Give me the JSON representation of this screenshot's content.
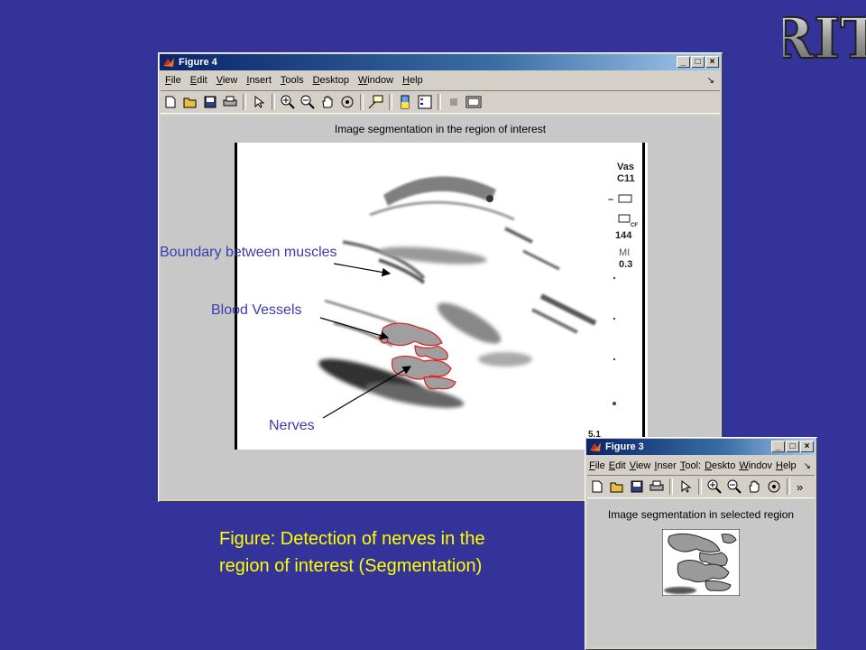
{
  "logo": {
    "text": "RIT"
  },
  "figure4": {
    "title": "Figure 4",
    "menu": [
      "File",
      "Edit",
      "View",
      "Insert",
      "Tools",
      "Desktop",
      "Window",
      "Help"
    ],
    "window_buttons": [
      "_",
      "□",
      "×"
    ],
    "plot_title": "Image segmentation in the region of interest",
    "side_text": {
      "vas": "Vas",
      "c11": "C11",
      "dash": "–",
      "cf": "CF",
      "n144": "144",
      "mi": "MI",
      "mi_val": "0.3",
      "scale": "5.1"
    }
  },
  "annotations": {
    "boundary": "Boundary between muscles",
    "blood": "Blood Vessels",
    "nerves": "Nerves"
  },
  "caption": {
    "line1": "Figure: Detection of nerves in the",
    "line2": "region of interest (Segmentation)"
  },
  "figure3": {
    "title": "Figure 3",
    "menu": [
      "File",
      "Edit",
      "View",
      "Inser",
      "Tool:",
      "Deskto",
      "Windov",
      "Help"
    ],
    "window_buttons": [
      "_",
      "□",
      "×"
    ],
    "overflow": "»",
    "plot_title": "Image segmentation in selected region"
  },
  "colors": {
    "background": "#33339a",
    "caption": "#ffff00",
    "annotation": "#3b3bb0",
    "contour": "#e01010"
  }
}
